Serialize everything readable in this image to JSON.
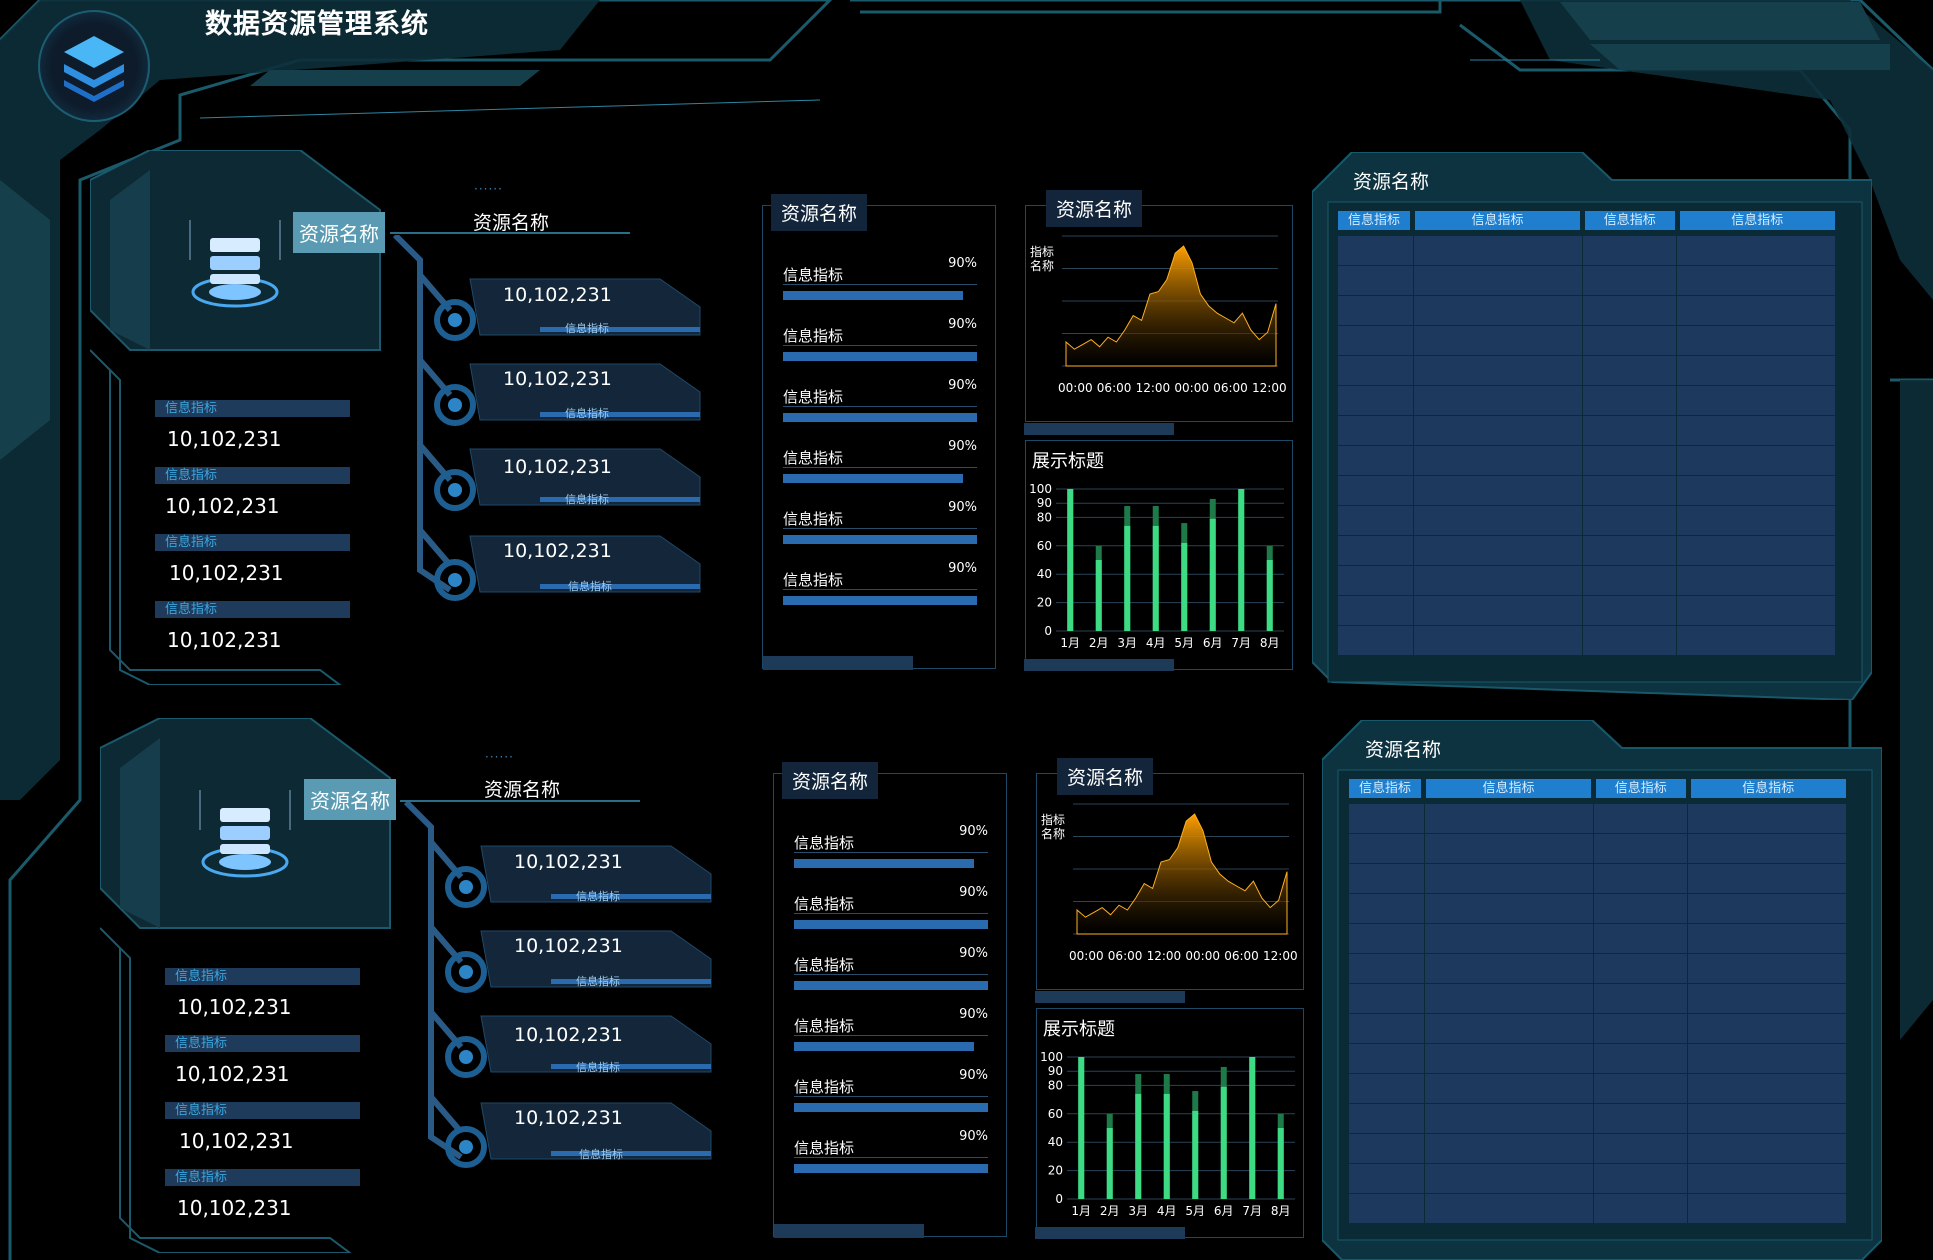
{
  "app": {
    "title": "数据资源管理系统"
  },
  "groups": [
    {
      "resource_tag": "资源名称",
      "section_title": "资源名称",
      "metrics": [
        {
          "label": "信息指标",
          "value": "10,102,231"
        },
        {
          "label": "信息指标",
          "value": "10,102,231"
        },
        {
          "label": "信息指标",
          "value": "10,102,231"
        },
        {
          "label": "信息指标",
          "value": "10,102,231"
        }
      ],
      "nodes": [
        {
          "value": "10,102,231",
          "label": "信息指标"
        },
        {
          "value": "10,102,231",
          "label": "信息指标"
        },
        {
          "value": "10,102,231",
          "label": "信息指标"
        },
        {
          "value": "10,102,231",
          "label": "信息指标"
        }
      ],
      "progress_panel": {
        "title": "资源名称",
        "items": [
          {
            "label": "信息指标",
            "percent_text": "90%",
            "value": 0.93
          },
          {
            "label": "信息指标",
            "percent_text": "90%",
            "value": 1.0
          },
          {
            "label": "信息指标",
            "percent_text": "90%",
            "value": 1.0
          },
          {
            "label": "信息指标",
            "percent_text": "90%",
            "value": 0.93
          },
          {
            "label": "信息指标",
            "percent_text": "90%",
            "value": 1.0
          },
          {
            "label": "信息指标",
            "percent_text": "90%",
            "value": 1.0
          }
        ]
      },
      "area_panel": {
        "title": "资源名称"
      },
      "bar_panel": {
        "title": "展示标题"
      },
      "table_panel": {
        "title": "资源名称",
        "headers": [
          "信息指标",
          "信息指标",
          "信息指标",
          "信息指标"
        ]
      }
    },
    {
      "resource_tag": "资源名称",
      "section_title": "资源名称",
      "metrics": [
        {
          "label": "信息指标",
          "value": "10,102,231"
        },
        {
          "label": "信息指标",
          "value": "10,102,231"
        },
        {
          "label": "信息指标",
          "value": "10,102,231"
        },
        {
          "label": "信息指标",
          "value": "10,102,231"
        }
      ],
      "nodes": [
        {
          "value": "10,102,231",
          "label": "信息指标"
        },
        {
          "value": "10,102,231",
          "label": "信息指标"
        },
        {
          "value": "10,102,231",
          "label": "信息指标"
        },
        {
          "value": "10,102,231",
          "label": "信息指标"
        }
      ],
      "progress_panel": {
        "title": "资源名称",
        "items": [
          {
            "label": "信息指标",
            "percent_text": "90%",
            "value": 0.93
          },
          {
            "label": "信息指标",
            "percent_text": "90%",
            "value": 1.0
          },
          {
            "label": "信息指标",
            "percent_text": "90%",
            "value": 1.0
          },
          {
            "label": "信息指标",
            "percent_text": "90%",
            "value": 0.93
          },
          {
            "label": "信息指标",
            "percent_text": "90%",
            "value": 1.0
          },
          {
            "label": "信息指标",
            "percent_text": "90%",
            "value": 1.0
          }
        ]
      },
      "area_panel": {
        "title": "资源名称"
      },
      "bar_panel": {
        "title": "展示标题"
      },
      "table_panel": {
        "title": "资源名称",
        "headers": [
          "信息指标",
          "信息指标",
          "信息指标",
          "信息指标"
        ]
      }
    }
  ],
  "chart_data": [
    {
      "type": "area",
      "ylabel": "指标名称",
      "x": [
        "00:00",
        "06:00",
        "12:00",
        "00:00",
        "06:00",
        "12:00"
      ],
      "values": [
        20,
        14,
        18,
        22,
        16,
        24,
        20,
        30,
        42,
        38,
        60,
        62,
        72,
        94,
        100,
        86,
        60,
        50,
        44,
        40,
        36,
        44,
        30,
        22,
        28,
        52
      ],
      "color": "#ffa000"
    },
    {
      "type": "bar",
      "x": [
        "1月",
        "2月",
        "3月",
        "4月",
        "5月",
        "6月",
        "7月",
        "8月"
      ],
      "series": [
        {
          "values": [
            100,
            50,
            74,
            74,
            62,
            79,
            100,
            50
          ],
          "color": "#3ddc84"
        },
        {
          "values": [
            100,
            60,
            88,
            88,
            76,
            93,
            100,
            60
          ],
          "color": "#1f7a4a"
        }
      ],
      "ylim": [
        0,
        100
      ],
      "yticks": [
        0,
        20,
        40,
        60,
        80,
        90,
        100
      ]
    }
  ]
}
